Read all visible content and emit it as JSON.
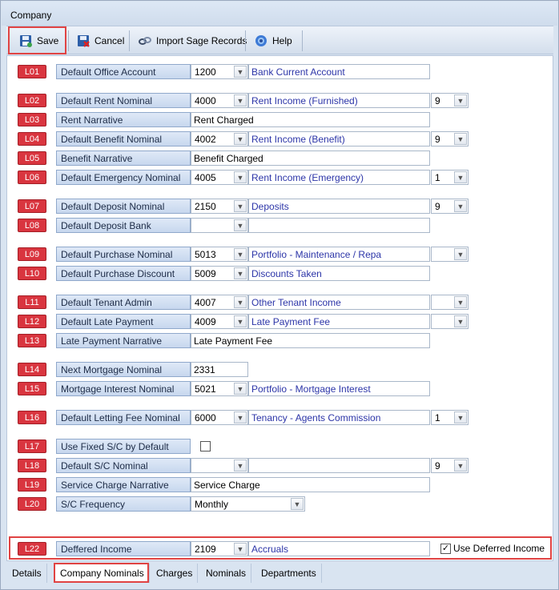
{
  "window": {
    "title": "Company"
  },
  "toolbar": {
    "save": "Save",
    "cancel": "Cancel",
    "import": "Import Sage Records",
    "help": "Help"
  },
  "rows": {
    "L01": {
      "code": "L01",
      "label": "Default Office Account",
      "nominal": "1200",
      "desc": "Bank Current Account"
    },
    "L02": {
      "code": "L02",
      "label": "Default Rent Nominal",
      "nominal": "4000",
      "desc": "Rent Income (Furnished)",
      "extra": "9"
    },
    "L03": {
      "code": "L03",
      "label": "Rent Narrative",
      "text": "Rent Charged"
    },
    "L04": {
      "code": "L04",
      "label": "Default Benefit Nominal",
      "nominal": "4002",
      "desc": "Rent Income (Benefit)",
      "extra": "9"
    },
    "L05": {
      "code": "L05",
      "label": "Benefit Narrative",
      "text": "Benefit Charged"
    },
    "L06": {
      "code": "L06",
      "label": "Default Emergency Nominal",
      "nominal": "4005",
      "desc": "Rent Income (Emergency)",
      "extra": "1"
    },
    "L07": {
      "code": "L07",
      "label": "Default Deposit Nominal",
      "nominal": "2150",
      "desc": "Deposits",
      "extra": "9"
    },
    "L08": {
      "code": "L08",
      "label": "Default Deposit Bank",
      "nominal": "",
      "desc": ""
    },
    "L09": {
      "code": "L09",
      "label": "Default Purchase Nominal",
      "nominal": "5013",
      "desc": "Portfolio - Maintenance / Repa",
      "extra": ""
    },
    "L10": {
      "code": "L10",
      "label": "Default Purchase Discount",
      "nominal": "5009",
      "desc": "Discounts Taken"
    },
    "L11": {
      "code": "L11",
      "label": "Default Tenant Admin",
      "nominal": "4007",
      "desc": "Other Tenant Income",
      "extra": ""
    },
    "L12": {
      "code": "L12",
      "label": "Default Late Payment",
      "nominal": "4009",
      "desc": "Late Payment Fee",
      "extra": ""
    },
    "L13": {
      "code": "L13",
      "label": "Late Payment Narrative",
      "text": "Late Payment Fee"
    },
    "L14": {
      "code": "L14",
      "label": "Next Mortgage Nominal",
      "text": "2331"
    },
    "L15": {
      "code": "L15",
      "label": "Mortgage Interest Nominal",
      "nominal": "5021",
      "desc": "Portfolio - Mortgage Interest"
    },
    "L16": {
      "code": "L16",
      "label": "Default Letting Fee Nominal",
      "nominal": "6000",
      "desc": "Tenancy - Agents Commission",
      "extra": "1"
    },
    "L17": {
      "code": "L17",
      "label": "Use Fixed S/C by Default"
    },
    "L18": {
      "code": "L18",
      "label": "Default S/C Nominal",
      "nominal": "",
      "desc": "",
      "extra": "9"
    },
    "L19": {
      "code": "L19",
      "label": "Service Charge Narrative",
      "text": "Service Charge"
    },
    "L20": {
      "code": "L20",
      "label": "S/C Frequency",
      "select": "Monthly"
    },
    "L22": {
      "code": "L22",
      "label": "Deffered Income",
      "nominal": "2109",
      "desc": "Accruals",
      "checkbox": "Use Deferred Income"
    }
  },
  "tabs": [
    "Details",
    "Company Nominals",
    "Charges",
    "Nominals",
    "Departments"
  ]
}
